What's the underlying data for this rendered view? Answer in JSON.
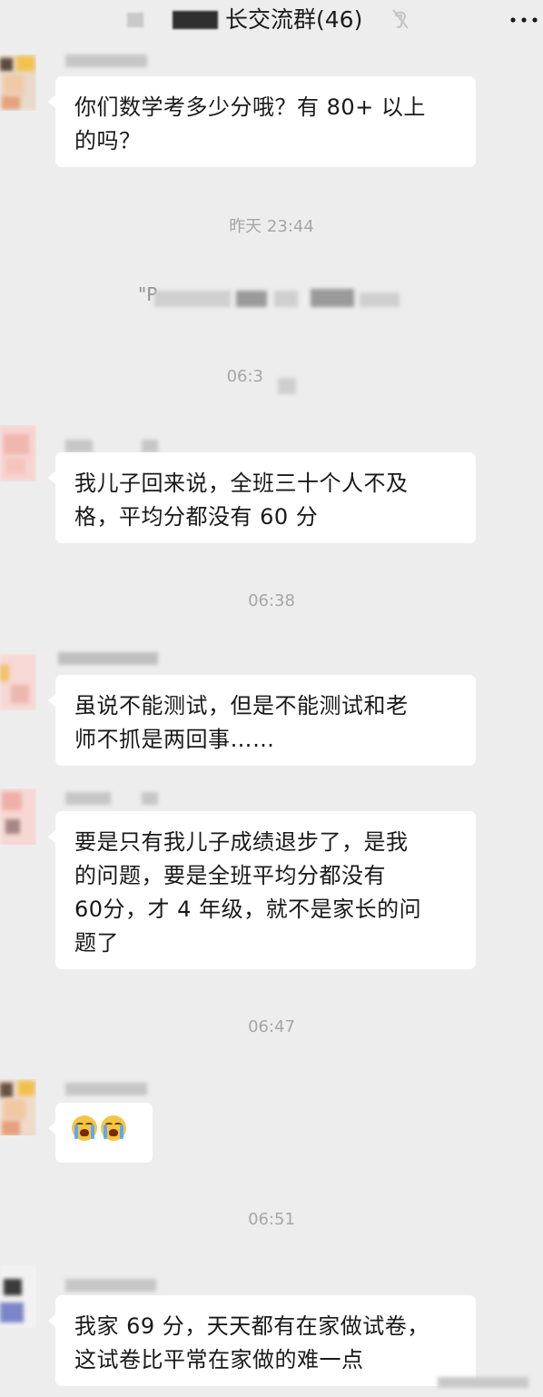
{
  "header": {
    "title": "长交流群(46)",
    "mute_icon": "ear-mute-icon",
    "more_icon": "more-dots-icon"
  },
  "messages": [
    {
      "lines": [
        "你们数学考多少分哦？有 80+ 以上",
        "的吗？"
      ]
    },
    {
      "lines": [
        "我儿子回来说，全班三十个人不及",
        "格，平均分都没有 60 分"
      ]
    },
    {
      "lines": [
        "虽说不能测试，但是不能测试和老",
        "师不抓是两回事……"
      ]
    },
    {
      "lines": [
        "要是只有我儿子成绩退步了，是我",
        "的问题，要是全班平均分都没有",
        "60分，才 4 年级，就不是家长的问",
        "题了"
      ]
    },
    {
      "emoji": "crying-emoji"
    },
    {
      "lines": [
        "我家 69 分，天天都有在家做试卷，",
        "这试卷比平常在家做的难一点"
      ]
    }
  ],
  "times": {
    "t1": "昨天 23:44",
    "t2": "06:3",
    "t3": "06:38",
    "t4": "06:47",
    "t5": "06:51"
  },
  "recall_prefix": "\"P",
  "colors": {
    "background": "#ededed",
    "bubble": "#ffffff",
    "text": "#191919",
    "timestamp": "#a6a6a6"
  }
}
